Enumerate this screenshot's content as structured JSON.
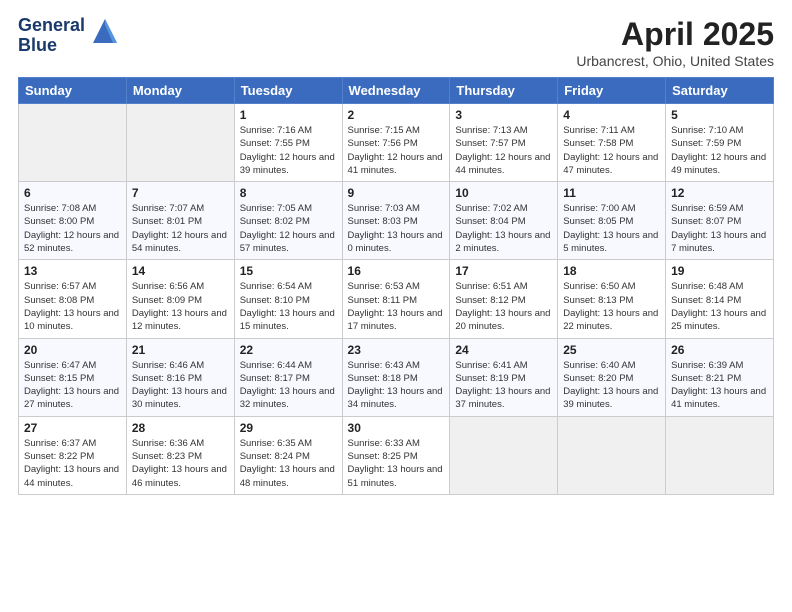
{
  "logo": {
    "line1": "General",
    "line2": "Blue"
  },
  "title": "April 2025",
  "subtitle": "Urbancrest, Ohio, United States",
  "weekdays": [
    "Sunday",
    "Monday",
    "Tuesday",
    "Wednesday",
    "Thursday",
    "Friday",
    "Saturday"
  ],
  "weeks": [
    [
      {
        "day": "",
        "info": ""
      },
      {
        "day": "",
        "info": ""
      },
      {
        "day": "1",
        "info": "Sunrise: 7:16 AM\nSunset: 7:55 PM\nDaylight: 12 hours and 39 minutes."
      },
      {
        "day": "2",
        "info": "Sunrise: 7:15 AM\nSunset: 7:56 PM\nDaylight: 12 hours and 41 minutes."
      },
      {
        "day": "3",
        "info": "Sunrise: 7:13 AM\nSunset: 7:57 PM\nDaylight: 12 hours and 44 minutes."
      },
      {
        "day": "4",
        "info": "Sunrise: 7:11 AM\nSunset: 7:58 PM\nDaylight: 12 hours and 47 minutes."
      },
      {
        "day": "5",
        "info": "Sunrise: 7:10 AM\nSunset: 7:59 PM\nDaylight: 12 hours and 49 minutes."
      }
    ],
    [
      {
        "day": "6",
        "info": "Sunrise: 7:08 AM\nSunset: 8:00 PM\nDaylight: 12 hours and 52 minutes."
      },
      {
        "day": "7",
        "info": "Sunrise: 7:07 AM\nSunset: 8:01 PM\nDaylight: 12 hours and 54 minutes."
      },
      {
        "day": "8",
        "info": "Sunrise: 7:05 AM\nSunset: 8:02 PM\nDaylight: 12 hours and 57 minutes."
      },
      {
        "day": "9",
        "info": "Sunrise: 7:03 AM\nSunset: 8:03 PM\nDaylight: 13 hours and 0 minutes."
      },
      {
        "day": "10",
        "info": "Sunrise: 7:02 AM\nSunset: 8:04 PM\nDaylight: 13 hours and 2 minutes."
      },
      {
        "day": "11",
        "info": "Sunrise: 7:00 AM\nSunset: 8:05 PM\nDaylight: 13 hours and 5 minutes."
      },
      {
        "day": "12",
        "info": "Sunrise: 6:59 AM\nSunset: 8:07 PM\nDaylight: 13 hours and 7 minutes."
      }
    ],
    [
      {
        "day": "13",
        "info": "Sunrise: 6:57 AM\nSunset: 8:08 PM\nDaylight: 13 hours and 10 minutes."
      },
      {
        "day": "14",
        "info": "Sunrise: 6:56 AM\nSunset: 8:09 PM\nDaylight: 13 hours and 12 minutes."
      },
      {
        "day": "15",
        "info": "Sunrise: 6:54 AM\nSunset: 8:10 PM\nDaylight: 13 hours and 15 minutes."
      },
      {
        "day": "16",
        "info": "Sunrise: 6:53 AM\nSunset: 8:11 PM\nDaylight: 13 hours and 17 minutes."
      },
      {
        "day": "17",
        "info": "Sunrise: 6:51 AM\nSunset: 8:12 PM\nDaylight: 13 hours and 20 minutes."
      },
      {
        "day": "18",
        "info": "Sunrise: 6:50 AM\nSunset: 8:13 PM\nDaylight: 13 hours and 22 minutes."
      },
      {
        "day": "19",
        "info": "Sunrise: 6:48 AM\nSunset: 8:14 PM\nDaylight: 13 hours and 25 minutes."
      }
    ],
    [
      {
        "day": "20",
        "info": "Sunrise: 6:47 AM\nSunset: 8:15 PM\nDaylight: 13 hours and 27 minutes."
      },
      {
        "day": "21",
        "info": "Sunrise: 6:46 AM\nSunset: 8:16 PM\nDaylight: 13 hours and 30 minutes."
      },
      {
        "day": "22",
        "info": "Sunrise: 6:44 AM\nSunset: 8:17 PM\nDaylight: 13 hours and 32 minutes."
      },
      {
        "day": "23",
        "info": "Sunrise: 6:43 AM\nSunset: 8:18 PM\nDaylight: 13 hours and 34 minutes."
      },
      {
        "day": "24",
        "info": "Sunrise: 6:41 AM\nSunset: 8:19 PM\nDaylight: 13 hours and 37 minutes."
      },
      {
        "day": "25",
        "info": "Sunrise: 6:40 AM\nSunset: 8:20 PM\nDaylight: 13 hours and 39 minutes."
      },
      {
        "day": "26",
        "info": "Sunrise: 6:39 AM\nSunset: 8:21 PM\nDaylight: 13 hours and 41 minutes."
      }
    ],
    [
      {
        "day": "27",
        "info": "Sunrise: 6:37 AM\nSunset: 8:22 PM\nDaylight: 13 hours and 44 minutes."
      },
      {
        "day": "28",
        "info": "Sunrise: 6:36 AM\nSunset: 8:23 PM\nDaylight: 13 hours and 46 minutes."
      },
      {
        "day": "29",
        "info": "Sunrise: 6:35 AM\nSunset: 8:24 PM\nDaylight: 13 hours and 48 minutes."
      },
      {
        "day": "30",
        "info": "Sunrise: 6:33 AM\nSunset: 8:25 PM\nDaylight: 13 hours and 51 minutes."
      },
      {
        "day": "",
        "info": ""
      },
      {
        "day": "",
        "info": ""
      },
      {
        "day": "",
        "info": ""
      }
    ]
  ]
}
